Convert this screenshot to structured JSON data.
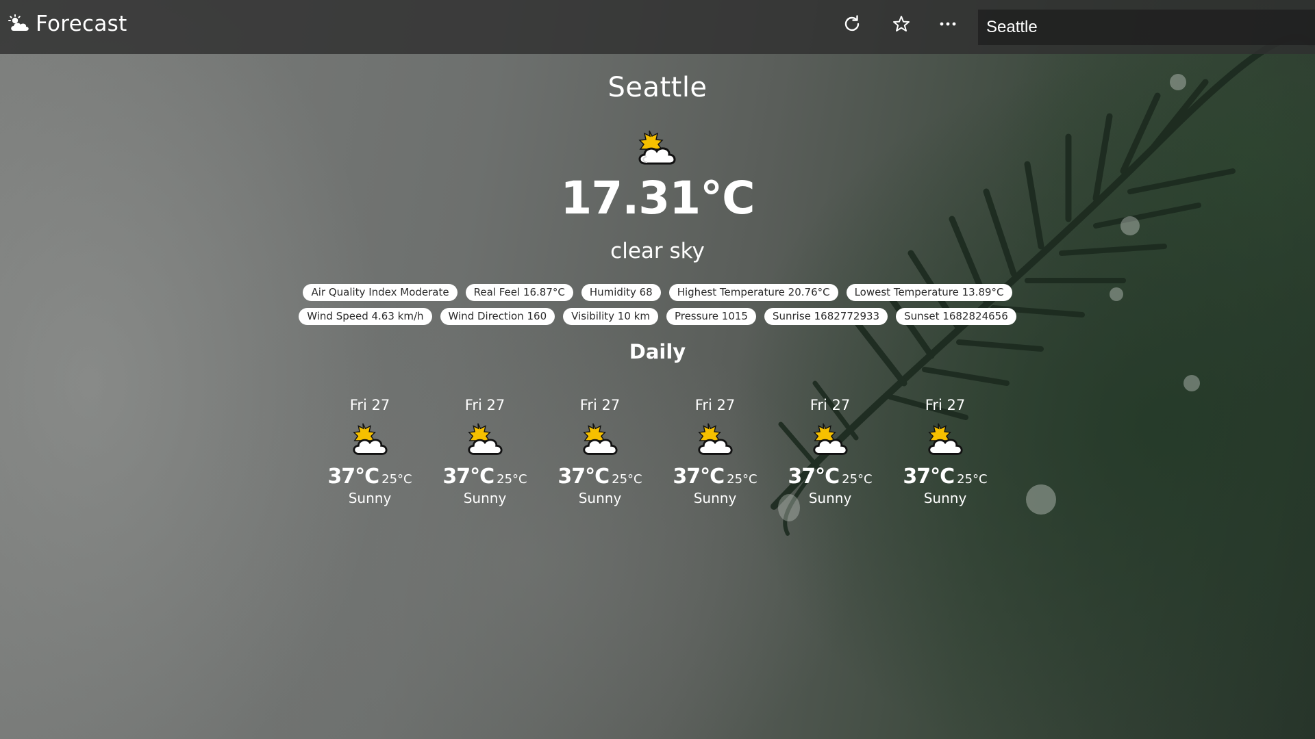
{
  "app": {
    "title": "Forecast",
    "logo_icon": "cloud-sun-icon"
  },
  "toolbar": {
    "refresh_icon": "refresh-icon",
    "favorite_icon": "star-icon",
    "more_icon": "more-horizontal-icon",
    "search_value": "Seattle"
  },
  "current": {
    "city": "Seattle",
    "icon": "partly-cloudy-icon",
    "temperature": "17.31°C",
    "description": "clear sky"
  },
  "details": [
    "Air Quality Index Moderate",
    "Real Feel 16.87°C",
    "Humidity 68",
    "Highest Temperature 20.76°C",
    "Lowest Temperature 13.89°C",
    "Wind Speed 4.63 km/h",
    "Wind Direction 160",
    "Visibility 10 km",
    "Pressure 1015",
    "Sunrise 1682772933",
    "Sunset 1682824656"
  ],
  "daily": {
    "title": "Daily",
    "days": [
      {
        "date": "Fri 27",
        "icon": "partly-cloudy-icon",
        "high": "37°C",
        "low": "25°C",
        "condition": "Sunny"
      },
      {
        "date": "Fri 27",
        "icon": "partly-cloudy-icon",
        "high": "37°C",
        "low": "25°C",
        "condition": "Sunny"
      },
      {
        "date": "Fri 27",
        "icon": "partly-cloudy-icon",
        "high": "37°C",
        "low": "25°C",
        "condition": "Sunny"
      },
      {
        "date": "Fri 27",
        "icon": "partly-cloudy-icon",
        "high": "37°C",
        "low": "25°C",
        "condition": "Sunny"
      },
      {
        "date": "Fri 27",
        "icon": "partly-cloudy-icon",
        "high": "37°C",
        "low": "25°C",
        "condition": "Sunny"
      },
      {
        "date": "Fri 27",
        "icon": "partly-cloudy-icon",
        "high": "37°C",
        "low": "25°C",
        "condition": "Sunny"
      }
    ]
  },
  "colors": {
    "topbar": "#303030",
    "chip_bg": "#ffffff",
    "chip_text": "#2b2b2b",
    "sun": "#f6c000",
    "cloud": "#ffffff"
  }
}
